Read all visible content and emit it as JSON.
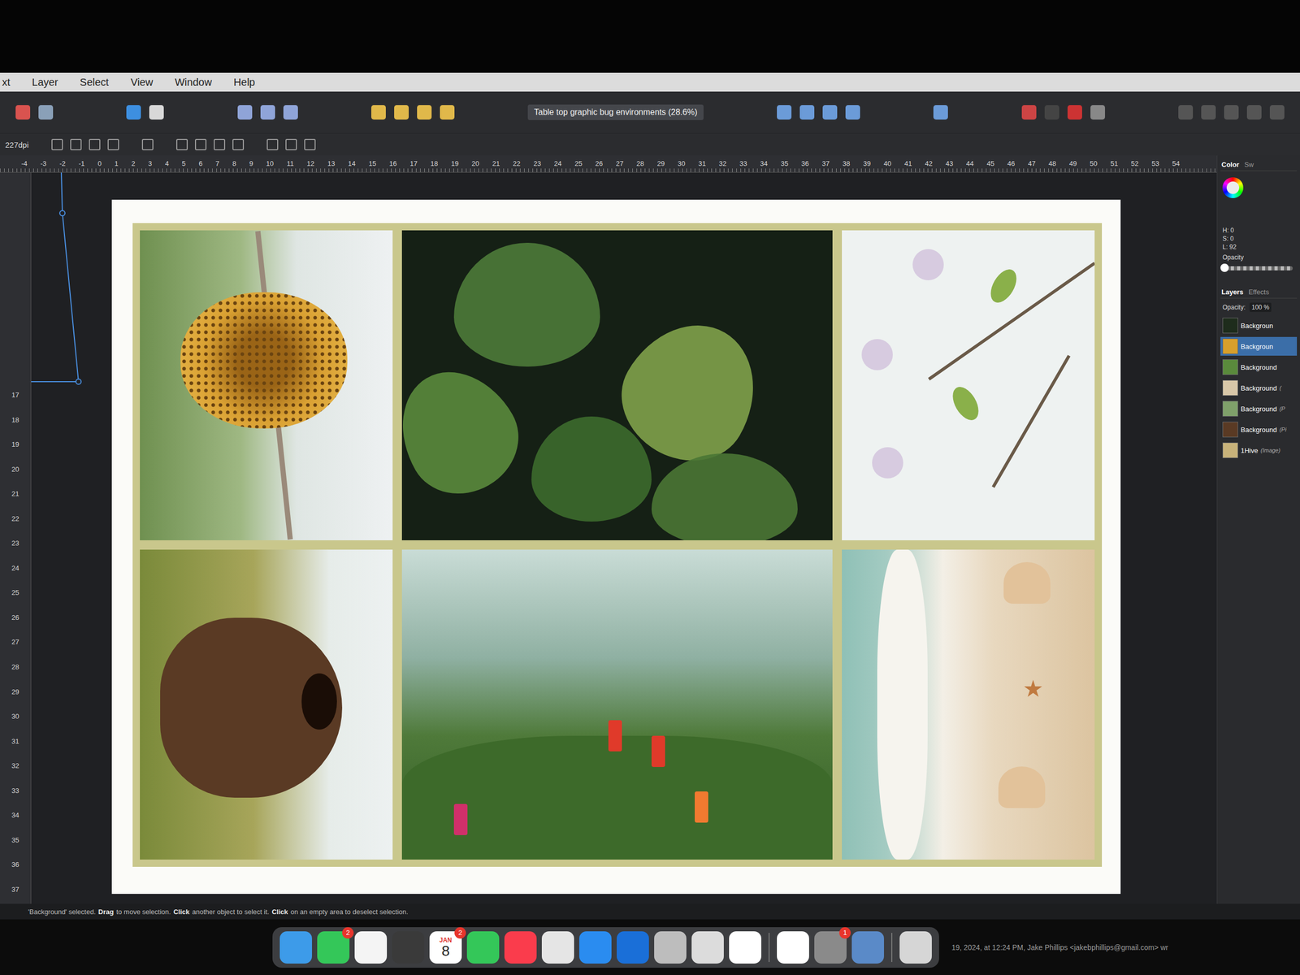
{
  "menu_bar": {
    "items": [
      "xt",
      "Layer",
      "Select",
      "View",
      "Window",
      "Help"
    ]
  },
  "document_title": "Table top graphic bug environments (28.6%)",
  "context_toolbar": {
    "dpi": "227dpi"
  },
  "ruler": {
    "horizontal": [
      "-4",
      "-3",
      "-2",
      "-1",
      "0",
      "1",
      "2",
      "3",
      "4",
      "5",
      "6",
      "7",
      "8",
      "9",
      "10",
      "11",
      "12",
      "13",
      "14",
      "15",
      "16",
      "17",
      "18",
      "19",
      "20",
      "21",
      "22",
      "23",
      "24",
      "25",
      "26",
      "27",
      "28",
      "29",
      "30",
      "31",
      "32",
      "33",
      "34",
      "35",
      "36",
      "37",
      "38",
      "39",
      "40",
      "41",
      "42",
      "43",
      "44",
      "45",
      "46",
      "47",
      "48",
      "49",
      "50",
      "51",
      "52",
      "53",
      "54"
    ],
    "vertical": [
      "17",
      "18",
      "19",
      "20",
      "21",
      "22",
      "23",
      "24",
      "25",
      "26",
      "27",
      "28",
      "29",
      "30",
      "31",
      "32",
      "33",
      "34",
      "35",
      "36",
      "37"
    ]
  },
  "color_panel": {
    "tabs": [
      {
        "label": "Color",
        "selected": true
      },
      {
        "label": "Sw",
        "selected": false
      }
    ],
    "readout": [
      "H: 0",
      "S: 0",
      "L: 92"
    ],
    "opacity_label": "Opacity",
    "level": 0
  },
  "layers_panel": {
    "tabs": [
      {
        "label": "Layers",
        "selected": true
      },
      {
        "label": "Effects",
        "selected": false
      }
    ],
    "opacity_label": "Opacity:",
    "opacity_value": "100 %",
    "layers": [
      {
        "name": "Backgroun",
        "detail": "",
        "selected": false
      },
      {
        "name": "Backgroun",
        "detail": "",
        "selected": true
      },
      {
        "name": "Background",
        "detail": "",
        "selected": false
      },
      {
        "name": "Background",
        "detail": "(",
        "selected": false
      },
      {
        "name": "Background",
        "detail": "(P",
        "selected": false
      },
      {
        "name": "Background",
        "detail": "(Pi",
        "selected": false
      },
      {
        "name": "1Hive",
        "detail": "(Image)",
        "selected": false
      }
    ]
  },
  "status_bar": {
    "segments": [
      {
        "text": "'Background' selected.",
        "bold": false
      },
      {
        "text": "Drag",
        "bold": true
      },
      {
        "text": "to move selection.",
        "bold": false
      },
      {
        "text": "Click",
        "bold": true
      },
      {
        "text": "another object to select it.",
        "bold": false
      },
      {
        "text": "Click",
        "bold": true
      },
      {
        "text": "on an empty area to deselect selection.",
        "bold": false
      }
    ]
  },
  "dock": {
    "items": [
      {
        "kind": "app",
        "badge": ""
      },
      {
        "kind": "app",
        "badge": "2"
      },
      {
        "kind": "app",
        "badge": ""
      },
      {
        "kind": "app",
        "badge": ""
      },
      {
        "kind": "calendar",
        "month": "JAN",
        "day": "8",
        "badge": "2"
      },
      {
        "kind": "app",
        "badge": ""
      },
      {
        "kind": "app",
        "badge": ""
      },
      {
        "kind": "app",
        "badge": ""
      },
      {
        "kind": "app",
        "badge": ""
      },
      {
        "kind": "app",
        "badge": ""
      },
      {
        "kind": "app",
        "badge": ""
      },
      {
        "kind": "app",
        "badge": ""
      },
      {
        "kind": "app",
        "badge": ""
      },
      {
        "kind": "separator"
      },
      {
        "kind": "app",
        "badge": ""
      },
      {
        "kind": "app",
        "badge": "1"
      },
      {
        "kind": "app",
        "badge": ""
      },
      {
        "kind": "separator"
      },
      {
        "kind": "app",
        "badge": ""
      }
    ]
  },
  "caption": "19, 2024, at 12:24 PM, Jake Phillips <jakebphillips@gmail.com> wr"
}
